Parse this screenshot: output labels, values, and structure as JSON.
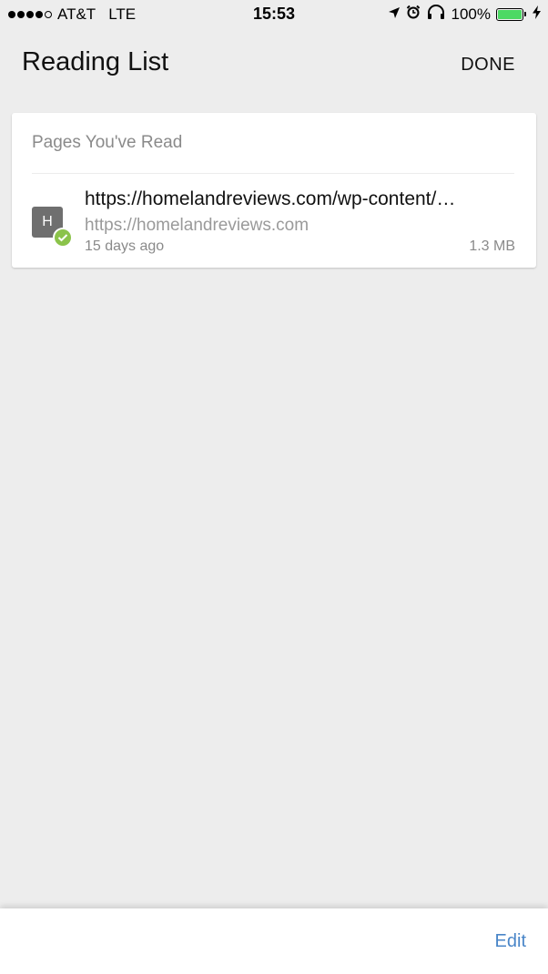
{
  "status_bar": {
    "carrier": "AT&T",
    "network": "LTE",
    "time": "15:53",
    "battery_percent": "100%",
    "signal_bars": 4,
    "signal_max": 5,
    "battery_level": 1.0,
    "battery_color": "#4cd964",
    "icons": [
      "location-arrow-icon",
      "alarm-clock-icon",
      "headphones-icon",
      "battery-icon",
      "charging-bolt-icon"
    ]
  },
  "header": {
    "title": "Reading List",
    "done_label": "DONE"
  },
  "section": {
    "title": "Pages You've Read",
    "items": [
      {
        "favicon_letter": "H",
        "title": "https://homelandreviews.com/wp-content/…",
        "url": "https://homelandreviews.com",
        "age": "15 days ago",
        "size": "1.3 MB",
        "status_icon": "read-check-icon",
        "status_color": "#8bc34a"
      }
    ]
  },
  "toolbar": {
    "edit_label": "Edit",
    "accent_color": "#4a86c8"
  }
}
